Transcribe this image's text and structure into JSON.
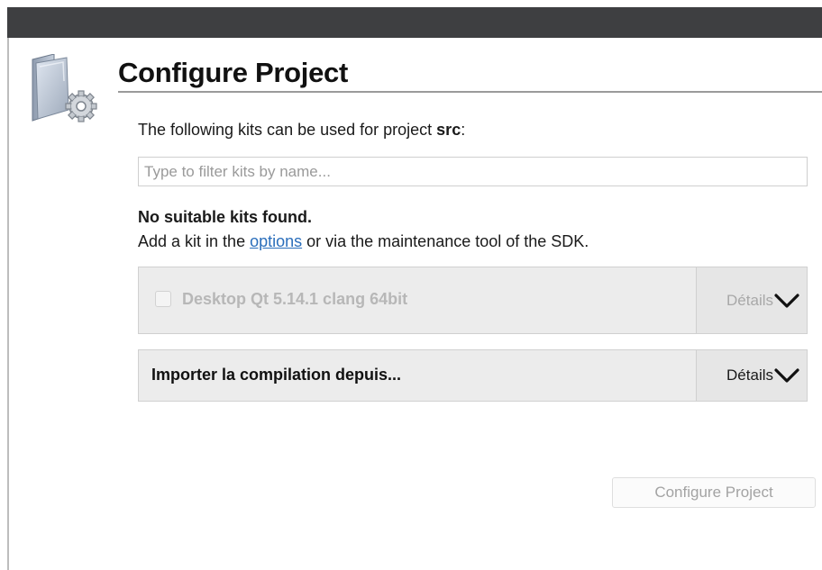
{
  "window": {
    "titlebar_color": "#3e3f41"
  },
  "header": {
    "icon": "folder-with-gear-icon",
    "title": "Configure Project"
  },
  "intro": {
    "prefix": "The following kits can be used for project ",
    "project_name": "src",
    "suffix": ":"
  },
  "filter": {
    "value": "",
    "placeholder": "Type to filter kits by name..."
  },
  "warning": {
    "heading": "No suitable kits found.",
    "line_prefix": "Add a kit in the ",
    "link_text": "options",
    "line_suffix": " or via the maintenance tool of the SDK."
  },
  "kits": [
    {
      "label": "Desktop Qt 5.14.1 clang 64bit",
      "checked": false,
      "enabled": false,
      "details_label": "Détails",
      "details_icon": "chevron-down-icon"
    }
  ],
  "import_build": {
    "label": "Importer la compilation depuis...",
    "details_label": "Détails",
    "details_icon": "chevron-down-icon"
  },
  "footer": {
    "configure_button_label": "Configure Project",
    "configure_button_enabled": false
  },
  "colors": {
    "link": "#2a6ebb",
    "panel_bg": "#ececec",
    "disabled_text": "#b7b7b7"
  }
}
